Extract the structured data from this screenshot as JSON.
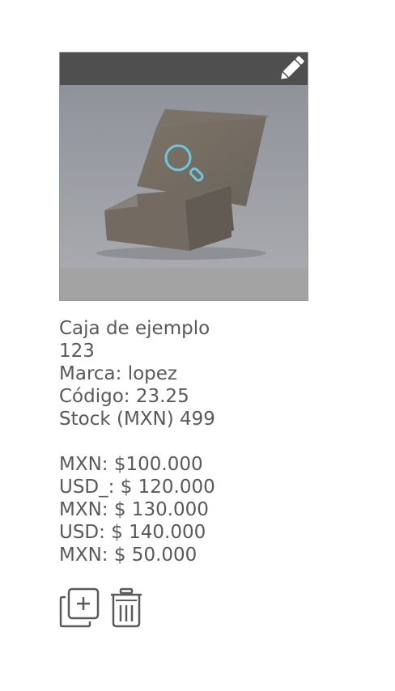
{
  "product": {
    "name": "Caja de ejemplo",
    "id": "123",
    "brand": "Marca: lopez",
    "code": "Código: 23.25",
    "stock": "Stock (MXN) 499"
  },
  "prices": [
    "MXN: $100.000",
    "USD_: $ 120.000",
    "MXN: $ 130.000",
    "USD: $ 140.000",
    "MXN: $ 50.000"
  ],
  "icons": {
    "edit": "pencil-icon",
    "zoom": "magnifier-icon",
    "duplicate": "duplicate-icon",
    "delete": "trash-icon"
  },
  "colors": {
    "top_bar": "#4f4f4f",
    "text": "#595959",
    "magnifier": "#6ec6dc"
  }
}
